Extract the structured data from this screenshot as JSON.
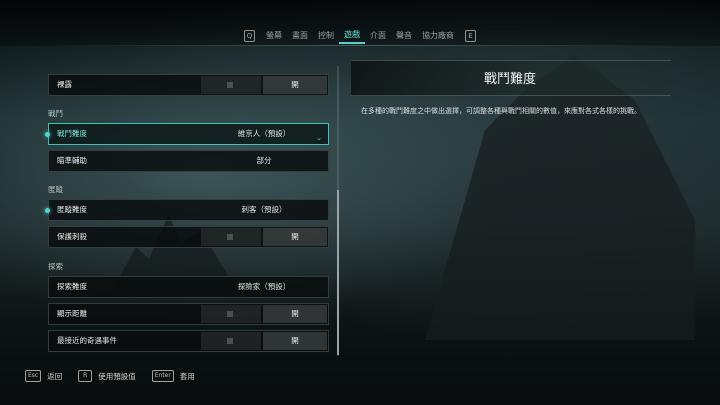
{
  "tabs": {
    "left_key": "Q",
    "right_key": "E",
    "items": [
      "螢幕",
      "畫面",
      "控制",
      "遊戲",
      "介面",
      "聲音",
      "協力廠商"
    ],
    "active": "遊戲"
  },
  "settings": {
    "row_top": {
      "label": "裸露",
      "value": "開"
    },
    "section_combat": "戰鬥",
    "combat_difficulty": {
      "label": "戰鬥難度",
      "value": "維京人（預設）"
    },
    "aim_assist": {
      "label": "瞄準輔助",
      "value": "部分"
    },
    "section_stealth": "匿蹤",
    "stealth_difficulty": {
      "label": "匿蹤難度",
      "value": "刺客（預設）"
    },
    "protect_stealth": {
      "label": "保護刺殺",
      "value": "開"
    },
    "section_explore": "探索",
    "explore_difficulty": {
      "label": "探索難度",
      "value": "探險家（預設）"
    },
    "show_distance": {
      "label": "顯示距離",
      "value": "開"
    },
    "nearest_event": {
      "label": "最接近的奇遇事件",
      "value": "開"
    }
  },
  "description": {
    "title": "戰鬥難度",
    "text": "在多種的戰鬥難度之中做出選擇，可調整各種與戰鬥相關的數值，來應對各式各樣的挑戰。"
  },
  "hints": {
    "back_key": "Esc",
    "back_label": "返回",
    "default_key": "R",
    "default_label": "使用預設值",
    "apply_key": "Enter",
    "apply_label": "套用"
  },
  "colors": {
    "accent": "#4ed6cc"
  }
}
